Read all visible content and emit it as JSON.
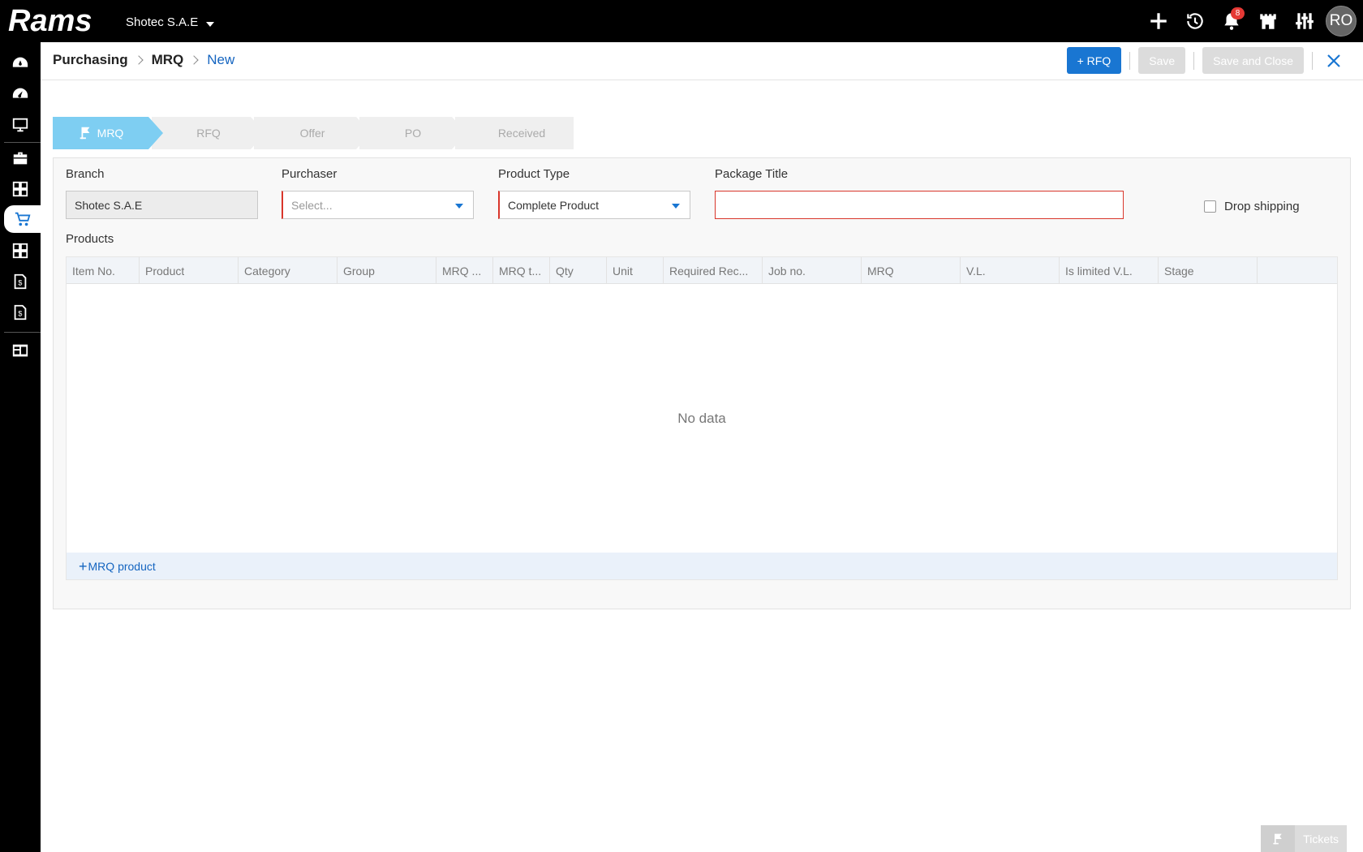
{
  "topbar": {
    "logo_text": "Rams",
    "company": "Shotec S.A.E",
    "notification_count": "8",
    "user_initials": "RO"
  },
  "sidebar": {
    "items": [
      {
        "icon": "dashboard-icon"
      },
      {
        "icon": "dashboard-alt-icon"
      },
      {
        "icon": "monitor-icon"
      },
      {
        "icon": "briefcase-icon"
      },
      {
        "icon": "layout-icon"
      },
      {
        "icon": "cart-icon",
        "active": true
      },
      {
        "icon": "layout-alt-icon"
      },
      {
        "icon": "invoice-icon"
      },
      {
        "icon": "invoice-alt-icon"
      },
      {
        "icon": "reports-icon"
      }
    ]
  },
  "breadcrumb": {
    "items": [
      "Purchasing",
      "MRQ",
      "New"
    ]
  },
  "actions": {
    "rfq_label": "+ RFQ",
    "save_label": "Save",
    "save_close_label": "Save and Close"
  },
  "stepper": {
    "steps": [
      "MRQ",
      "RFQ",
      "Offer",
      "PO",
      "Received"
    ],
    "active": "MRQ"
  },
  "form": {
    "branch": {
      "label": "Branch",
      "value": "Shotec S.A.E"
    },
    "purchaser": {
      "label": "Purchaser",
      "placeholder": "Select..."
    },
    "product_type": {
      "label": "Product Type",
      "value": "Complete Product"
    },
    "package_title": {
      "label": "Package Title",
      "value": ""
    },
    "drop_shipping": {
      "label": "Drop shipping",
      "checked": false
    },
    "products_label": "Products"
  },
  "grid": {
    "columns": [
      "Item No.",
      "Product",
      "Category",
      "Group",
      "MRQ ...",
      "MRQ t...",
      "Qty",
      "Unit",
      "Required Rec...",
      "Job no.",
      "MRQ",
      "V.L.",
      "Is limited V.L.",
      "Stage",
      ""
    ],
    "empty_text": "No data",
    "add_label": "MRQ product"
  },
  "tickets": {
    "label": "Tickets"
  },
  "colors": {
    "primary": "#1976d2",
    "active_step": "#7ecef2",
    "required": "#d9362b",
    "topbar": "#000000"
  }
}
